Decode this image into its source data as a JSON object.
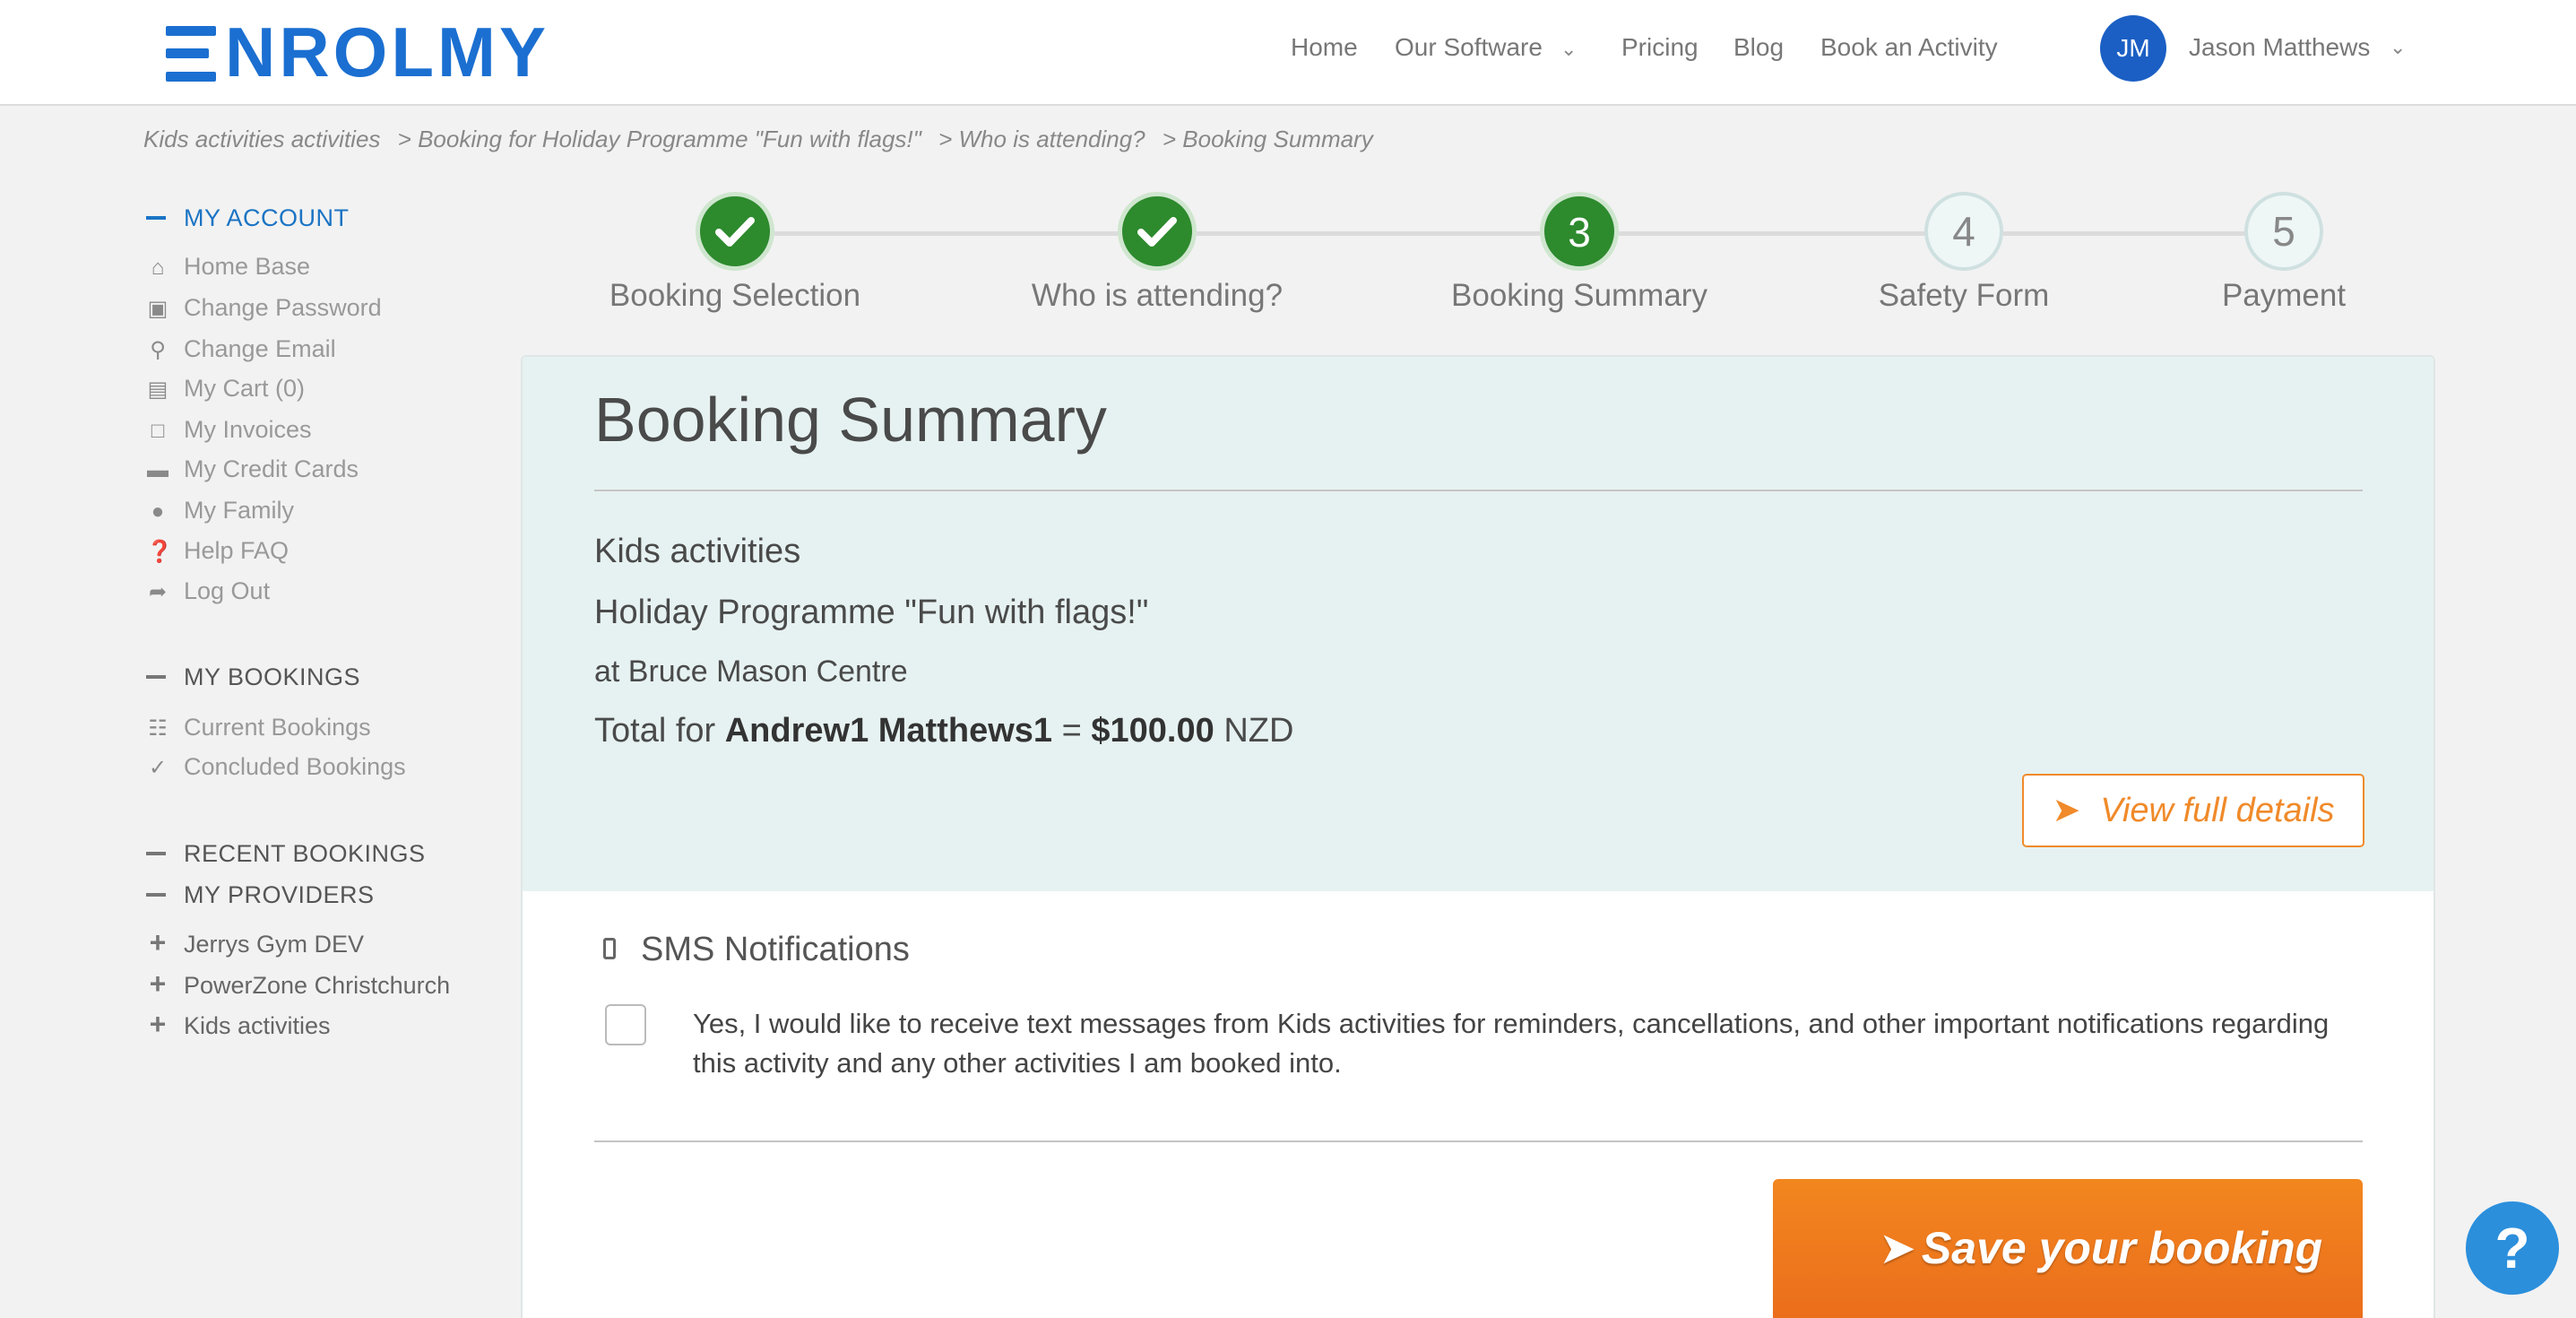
{
  "header": {
    "logo_text": "NROLMY",
    "nav": [
      "Home",
      "Our Software",
      "Pricing",
      "Blog",
      "Book an Activity"
    ],
    "user": {
      "initials": "JM",
      "name": "Jason Matthews"
    }
  },
  "breadcrumb": [
    "Kids activities activities",
    "> Booking for Holiday Programme \"Fun with flags!\"",
    "> Who is attending?",
    "> Booking Summary"
  ],
  "sidebar": {
    "my_account": "MY ACCOUNT",
    "account_items": [
      "Home Base",
      "Change Password",
      "Change Email",
      "My Cart (0)",
      "My Invoices",
      "My Credit Cards",
      "My Family",
      "Help FAQ",
      "Log Out"
    ],
    "my_bookings": "MY BOOKINGS",
    "booking_items": [
      "Current Bookings",
      "Concluded Bookings"
    ],
    "recent_bookings": "RECENT BOOKINGS",
    "my_providers": "MY PROVIDERS",
    "provider_items": [
      "Jerrys Gym DEV",
      "PowerZone Christchurch",
      "Kids activities"
    ]
  },
  "steps": [
    {
      "label": "Booking Selection",
      "number": "1",
      "state": "done"
    },
    {
      "label": "Who is attending?",
      "number": "2",
      "state": "done"
    },
    {
      "label": "Booking Summary",
      "number": "3",
      "state": "current"
    },
    {
      "label": "Safety Form",
      "number": "4",
      "state": "todo"
    },
    {
      "label": "Payment",
      "number": "5",
      "state": "todo"
    }
  ],
  "summary": {
    "title": "Booking Summary",
    "provider": "Kids activities",
    "programme": "Holiday Programme \"Fun with flags!\"",
    "venue": "at Bruce Mason Centre",
    "total_prefix": "Total for",
    "attendee": "Andrew1 Matthews1",
    "equals": "=",
    "amount": "$100.00",
    "currency": "NZD",
    "view_details": "View full details"
  },
  "sms": {
    "heading": "SMS Notifications",
    "consent_text": "Yes, I would like to receive text messages from Kids activities for reminders, cancellations, and other important notifications regarding this activity and any other activities I am booked into."
  },
  "actions": {
    "save_label": "Save your booking"
  },
  "help": {
    "label": "?"
  },
  "colors": {
    "brand_blue": "#1b6fd1",
    "step_green": "#2d8a2d",
    "accent_orange": "#f08a2a",
    "card_tint": "#e6f2f1"
  }
}
